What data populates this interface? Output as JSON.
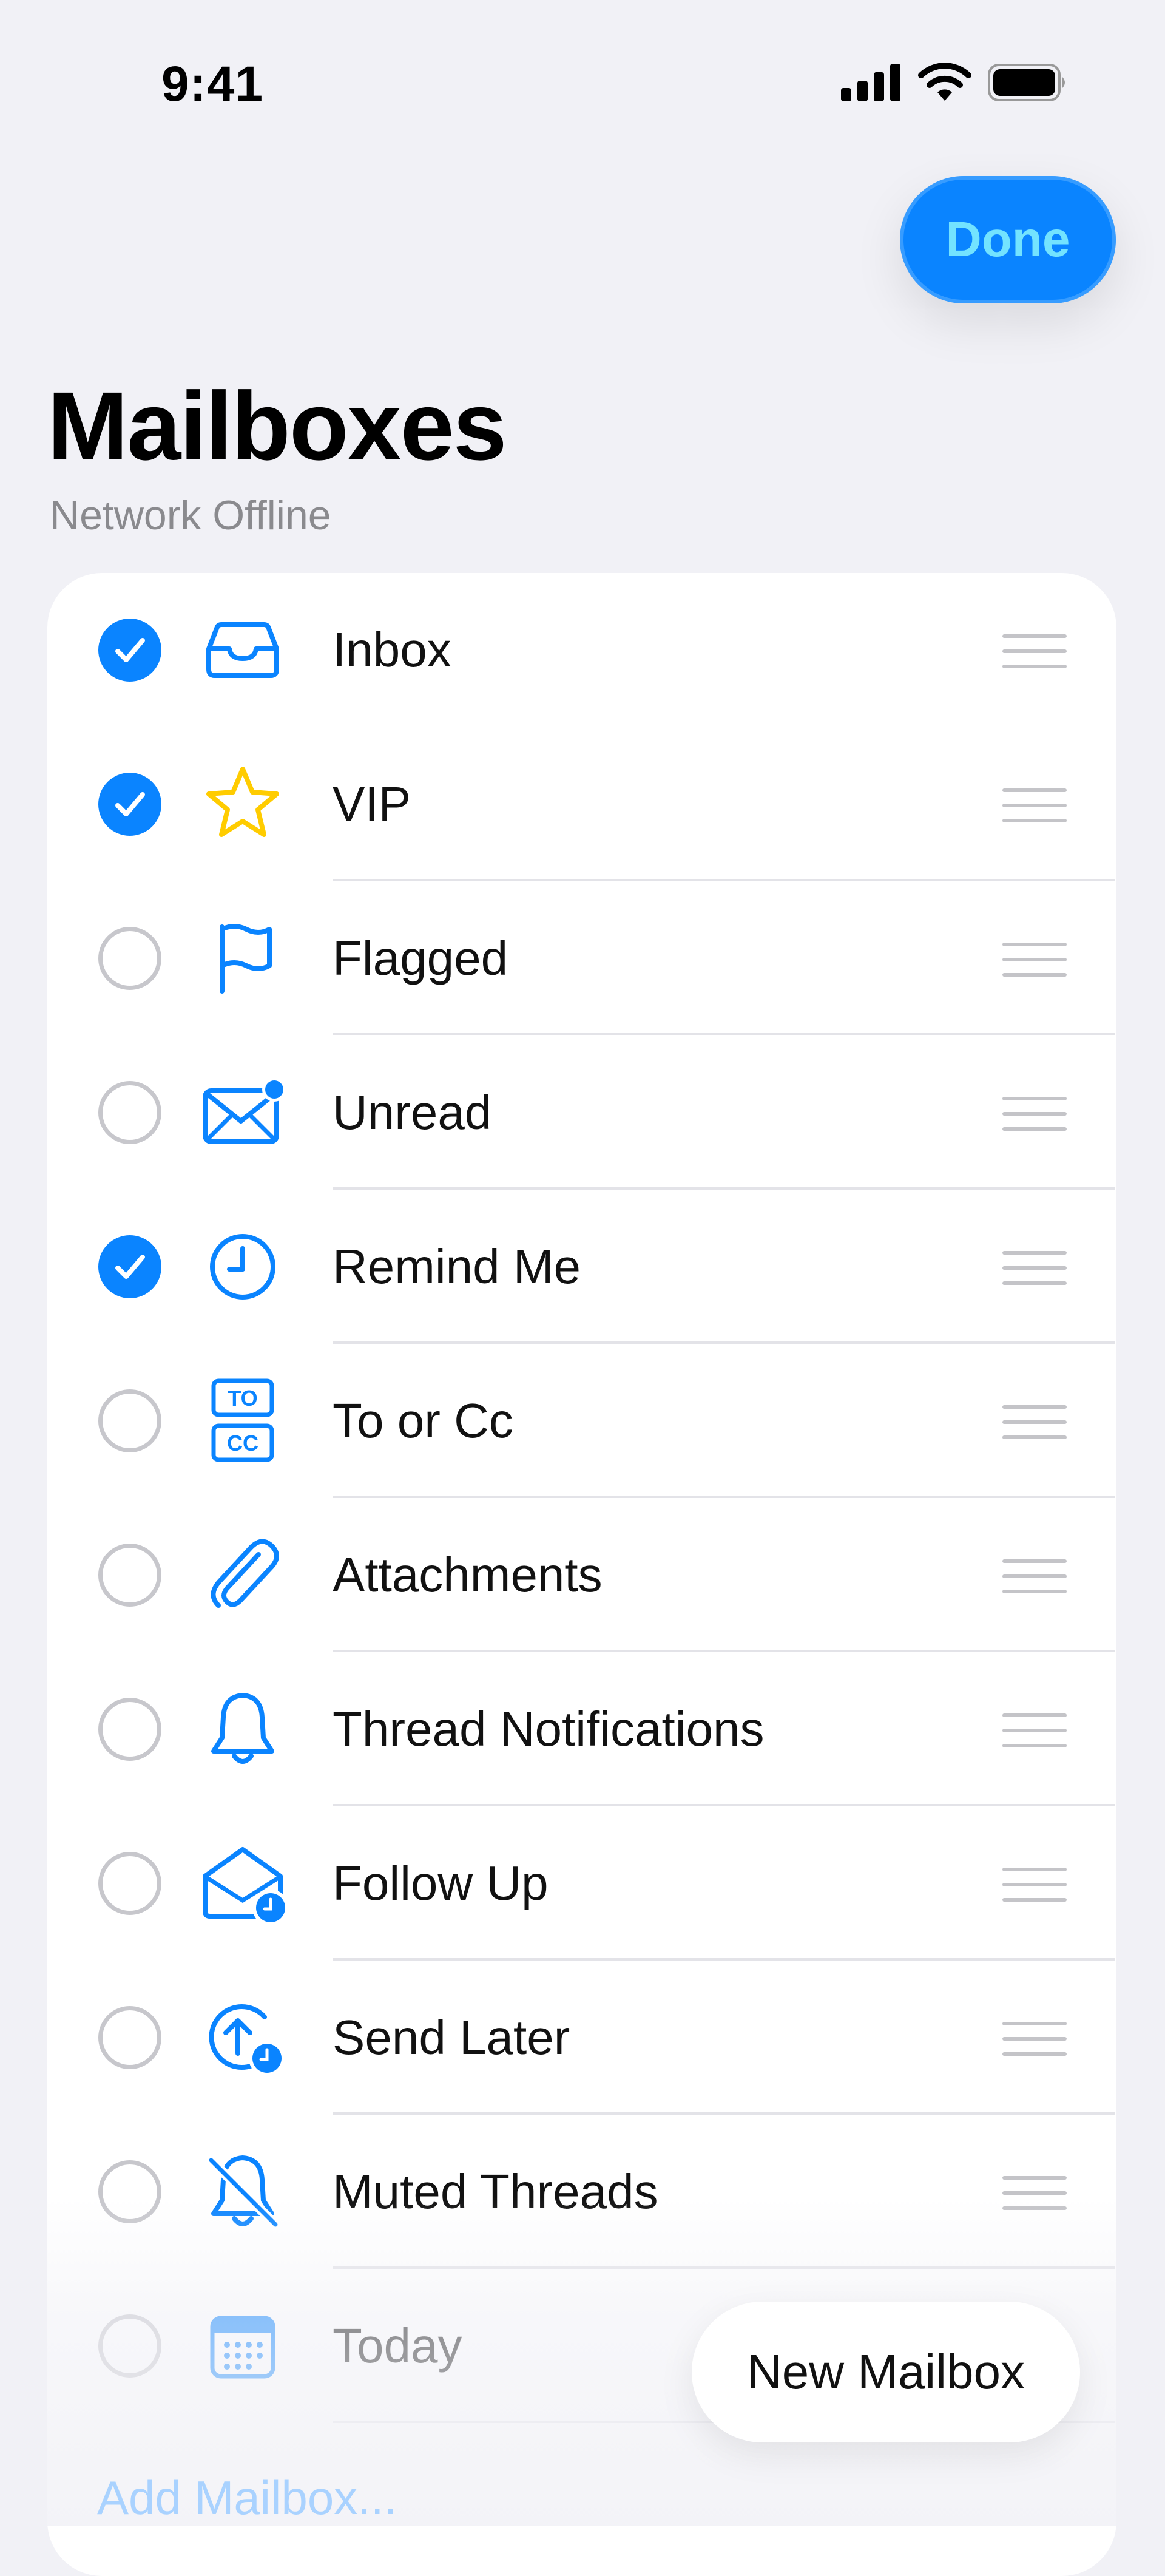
{
  "status_bar": {
    "time": "9:41"
  },
  "header": {
    "done_label": "Done",
    "title": "Mailboxes",
    "subtitle": "Network Offline"
  },
  "mailboxes": [
    {
      "label": "Inbox",
      "checked": true,
      "icon": "inbox-tray-icon"
    },
    {
      "label": "VIP",
      "checked": true,
      "icon": "star-icon"
    },
    {
      "label": "Flagged",
      "checked": false,
      "icon": "flag-icon"
    },
    {
      "label": "Unread",
      "checked": false,
      "icon": "unread-envelope-icon"
    },
    {
      "label": "Remind Me",
      "checked": true,
      "icon": "clock-icon"
    },
    {
      "label": "To or Cc",
      "checked": false,
      "icon": "to-cc-icon"
    },
    {
      "label": "Attachments",
      "checked": false,
      "icon": "paperclip-icon"
    },
    {
      "label": "Thread Notifications",
      "checked": false,
      "icon": "bell-icon"
    },
    {
      "label": "Follow Up",
      "checked": false,
      "icon": "envelope-clock-icon"
    },
    {
      "label": "Send Later",
      "checked": false,
      "icon": "send-later-icon"
    },
    {
      "label": "Muted Threads",
      "checked": false,
      "icon": "bell-slash-icon"
    },
    {
      "label": "Today",
      "checked": false,
      "icon": "calendar-icon"
    }
  ],
  "footer": {
    "add_mailbox_label": "Add Mailbox...",
    "new_mailbox_label": "New Mailbox"
  },
  "colors": {
    "accent": "#0a84ff",
    "vip_star": "#ffcc00",
    "background": "#f1f1f6"
  }
}
